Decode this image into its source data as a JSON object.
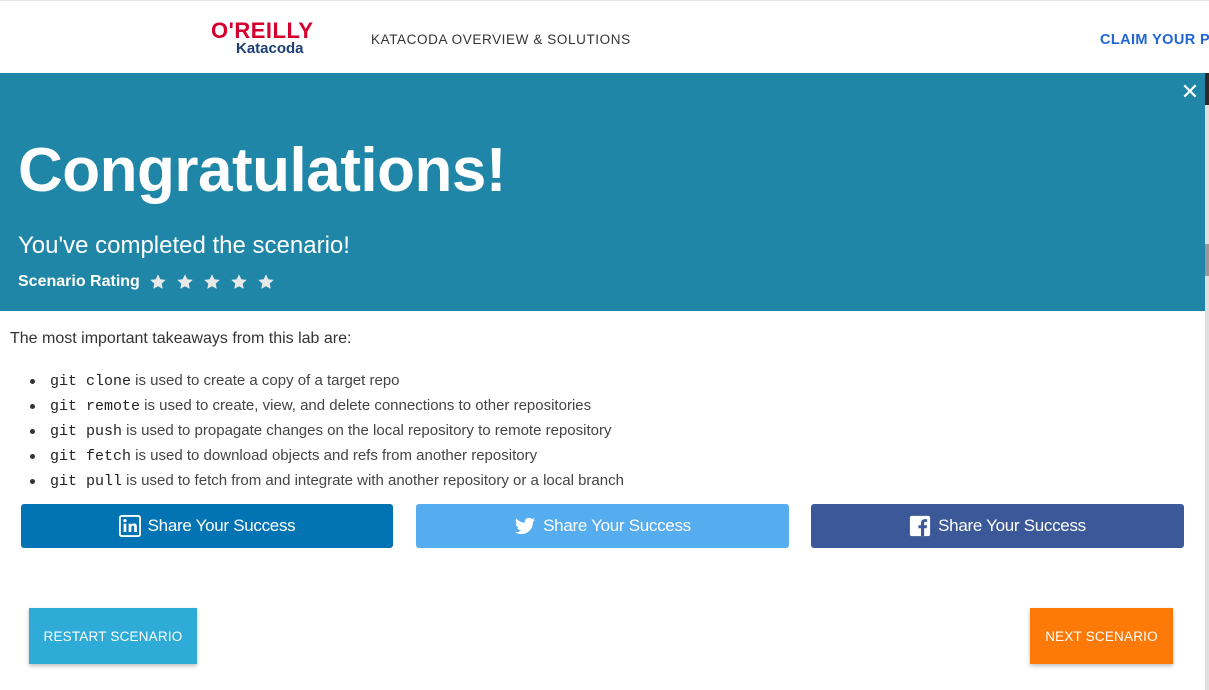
{
  "header": {
    "logo_brand": "O'REILLY",
    "logo_sub": "Katacoda",
    "nav_link": "KATACODA OVERVIEW & SOLUTIONS",
    "claim_link": "CLAIM YOUR PR"
  },
  "modal": {
    "close_icon": "close-icon",
    "headline": "Congratulations!",
    "subhead": "You've completed the scenario!",
    "rating_label": "Scenario Rating",
    "rating_stars": 5,
    "banner_color": "#1f86a7"
  },
  "takeaways": {
    "intro": "The most important takeaways from this lab are:",
    "items": [
      {
        "code": "git clone",
        "text": " is used to create a copy of a target repo"
      },
      {
        "code": "git remote",
        "text": " is used to create, view, and delete connections to other repositories"
      },
      {
        "code": "git push",
        "text": " is used to propagate changes on the local repository to remote repository"
      },
      {
        "code": "git fetch",
        "text": " is used to download objects and refs from another repository"
      },
      {
        "code": "git pull",
        "text": " is used to fetch from and integrate with another repository or a local branch"
      }
    ]
  },
  "share": {
    "linkedin": {
      "label": "Share Your Success",
      "icon": "linkedin-icon",
      "color": "#0274b3"
    },
    "twitter": {
      "label": "Share Your Success",
      "icon": "twitter-icon",
      "color": "#55acee"
    },
    "facebook": {
      "label": "Share Your Success",
      "icon": "facebook-icon",
      "color": "#3b5998"
    }
  },
  "actions": {
    "restart_label": "RESTART SCENARIO",
    "next_label": "NEXT SCENARIO",
    "restart_color": "#2eabd6",
    "next_color": "#fd7a08"
  }
}
